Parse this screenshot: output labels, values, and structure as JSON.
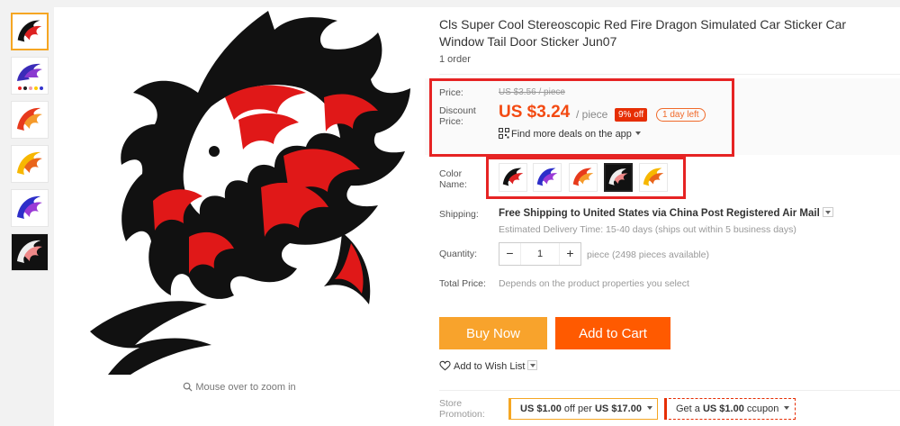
{
  "gallery": {
    "thumbnails": [
      "black-red",
      "blue-purple",
      "orange-red",
      "yellow-orange",
      "blue-purple-2",
      "black-white"
    ],
    "zoom_hint": "Mouse over to zoom in"
  },
  "product": {
    "title": "Cls Super Cool Stereoscopic Red Fire Dragon Simulated Car Sticker Car Window Tail Door Sticker Jun07",
    "orders": "1 order"
  },
  "price": {
    "label": "Price:",
    "original": "US $3.56 / piece",
    "discount_label": "Discount Price:",
    "discount_value": "US $3.24",
    "per_piece": "/ piece",
    "off_badge": "9% off",
    "days_left": "1 day left",
    "app_deals": "Find more deals on the app"
  },
  "color": {
    "label": "Color Name:",
    "options": [
      "black-red",
      "blue-purple",
      "orange-red",
      "black-white",
      "yellow-orange"
    ],
    "selected": "black-white"
  },
  "shipping": {
    "label": "Shipping:",
    "value": "Free Shipping to United States via China Post Registered Air Mail",
    "delivery": "Estimated Delivery Time: 15-40 days (ships out within 5 business days)"
  },
  "quantity": {
    "label": "Quantity:",
    "value": "1",
    "minus": "−",
    "plus": "+",
    "available": "piece (2498 pieces available)"
  },
  "total": {
    "label": "Total Price:",
    "value": "Depends on the product properties you select"
  },
  "actions": {
    "buy_now": "Buy Now",
    "add_to_cart": "Add to Cart",
    "wish_list": "Add to Wish List"
  },
  "promotion": {
    "label": "Store Promotion:",
    "coupon1_prefix": "US $1.00",
    "coupon1_mid": " off per ",
    "coupon1_suffix": "US $17.00",
    "coupon2_prefix": "Get a ",
    "coupon2_value": "US $1.00",
    "coupon2_suffix": " ccupon"
  },
  "colors": {
    "accent": "#f34a12",
    "buy": "#f8a32c",
    "cart": "#ff5a00",
    "highlight": "#e62323"
  }
}
